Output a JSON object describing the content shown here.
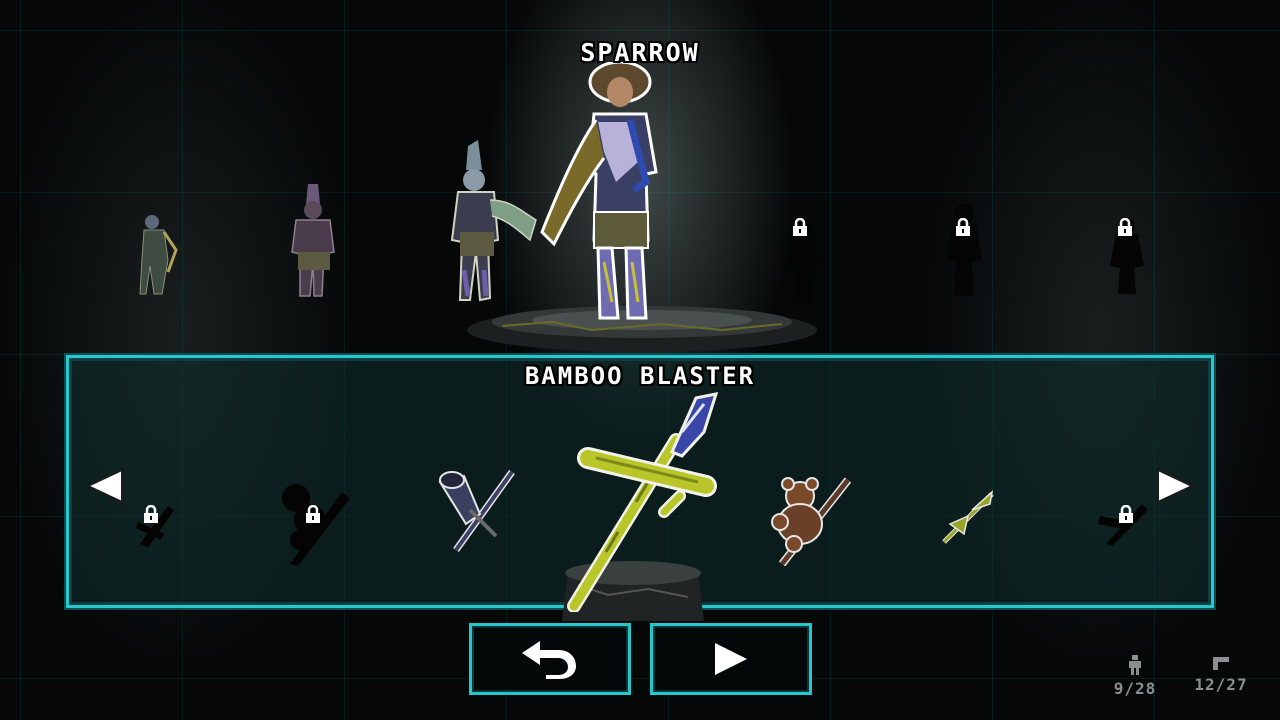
{
  "character": {
    "name": "SPARROW"
  },
  "weapon": {
    "name": "BAMBOO BLASTER"
  },
  "counters": {
    "characters": "9/28",
    "weapons": "12/27"
  },
  "buttons": {
    "back_icon": "undo-arrow-icon",
    "play_icon": "play-icon"
  },
  "colors": {
    "accent": "#27c9cc",
    "weapon_green": "#b8c62a",
    "text": "#ffffff",
    "counter_text": "#8a8f8f"
  }
}
